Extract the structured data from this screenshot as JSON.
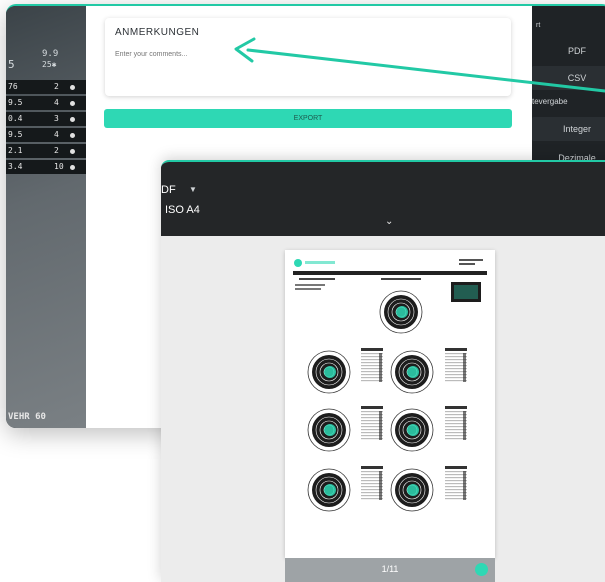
{
  "left_panel": {
    "head_a": "9.9",
    "head_b": "5",
    "head_c": "25✱",
    "rows": [
      {
        "value": "76",
        "count": "2"
      },
      {
        "value": "9.5",
        "count": "4"
      },
      {
        "value": "0.4",
        "count": "3"
      },
      {
        "value": "9.5",
        "count": "4"
      },
      {
        "value": "2.1",
        "count": "2"
      },
      {
        "value": "3.4",
        "count": "10"
      }
    ],
    "footer": "VEHR 60"
  },
  "notes": {
    "title": "ANMERKUNGEN",
    "placeholder": "Enter your comments..."
  },
  "export": {
    "label": "EXPORT"
  },
  "right_panel": {
    "top": "rt",
    "formats": [
      "PDF",
      "CSV"
    ],
    "label": "tevergabe",
    "precision": [
      "Integer",
      "Dezimale"
    ]
  },
  "preview": {
    "format": "DF",
    "paper_size": "ISO A4",
    "page_counter": "1/11"
  },
  "icons": {
    "format_caret": "caret-down-icon",
    "collapse": "chevron-down-icon",
    "page_ok": "check-circle-icon"
  },
  "colors": {
    "accent": "#2ed8b4",
    "dark": "#1e2428"
  }
}
